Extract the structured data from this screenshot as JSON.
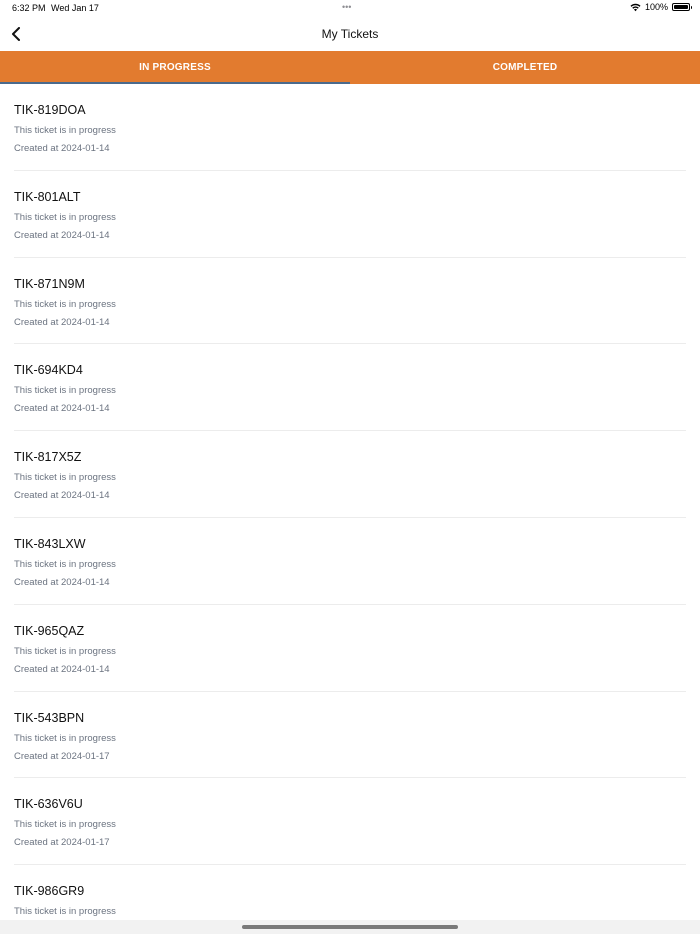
{
  "status_bar": {
    "time": "6:32 PM",
    "date": "Wed Jan 17",
    "dots": "•••",
    "battery": "100%",
    "icons": [
      "wifi-icon",
      "battery-icon"
    ]
  },
  "nav": {
    "title": "My Tickets",
    "back_icon": "chevron-left-icon"
  },
  "tabs": [
    {
      "label": "IN PROGRESS",
      "active": true
    },
    {
      "label": "COMPLETED",
      "active": false
    }
  ],
  "colors": {
    "tab_bar": "#e27b2f",
    "active_indicator": "#4a6a8c"
  },
  "tickets": [
    {
      "id": "TIK-819DOA",
      "status": "This ticket is in progress",
      "created": "Created at 2024-01-14"
    },
    {
      "id": "TIK-801ALT",
      "status": "This ticket is in progress",
      "created": "Created at 2024-01-14"
    },
    {
      "id": "TIK-871N9M",
      "status": "This ticket is in progress",
      "created": "Created at 2024-01-14"
    },
    {
      "id": "TIK-694KD4",
      "status": "This ticket is in progress",
      "created": "Created at 2024-01-14"
    },
    {
      "id": "TIK-817X5Z",
      "status": "This ticket is in progress",
      "created": "Created at 2024-01-14"
    },
    {
      "id": "TIK-843LXW",
      "status": "This ticket is in progress",
      "created": "Created at 2024-01-14"
    },
    {
      "id": "TIK-965QAZ",
      "status": "This ticket is in progress",
      "created": "Created at 2024-01-14"
    },
    {
      "id": "TIK-543BPN",
      "status": "This ticket is in progress",
      "created": "Created at 2024-01-17"
    },
    {
      "id": "TIK-636V6U",
      "status": "This ticket is in progress",
      "created": "Created at 2024-01-17"
    },
    {
      "id": "TIK-986GR9",
      "status": "This ticket is in progress",
      "created": ""
    }
  ]
}
